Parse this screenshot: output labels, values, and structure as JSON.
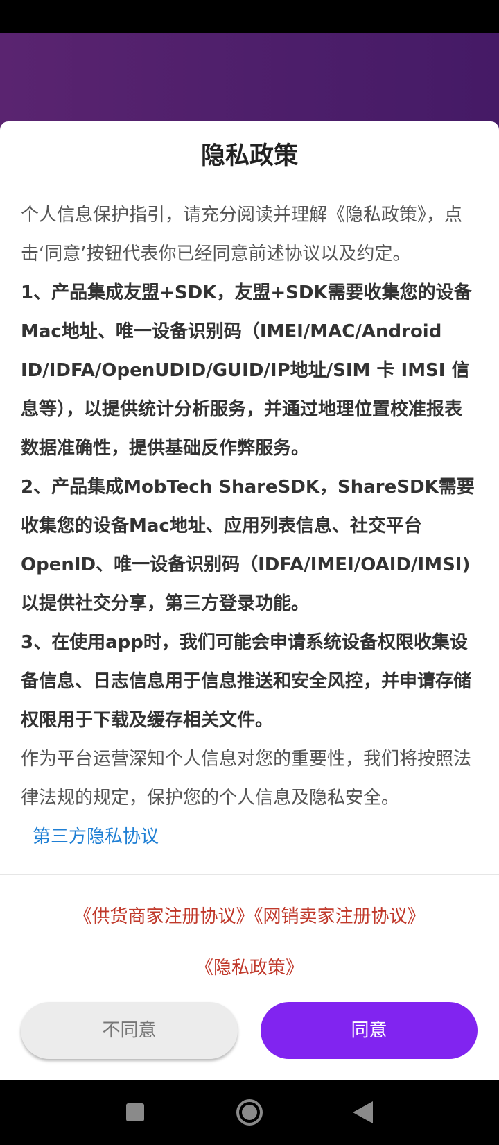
{
  "dialog": {
    "title": "隐私政策",
    "intro": "个人信息保护指引，请充分阅读并理解《隐私政策》，点击‘同意’按钮代表你已经同意前述协议以及约定。",
    "items": [
      "1、产品集成友盟+SDK，友盟+SDK需要收集您的设备Mac地址、唯一设备识别码（IMEI/MAC/Android ID/IDFA/OpenUDID/GUID/IP地址/SIM 卡 IMSI 信息等），以提供统计分析服务，并通过地理位置校准报表数据准确性，提供基础反作弊服务。",
      "2、产品集成MobTech ShareSDK，ShareSDK需要收集您的设备Mac地址、应用列表信息、社交平台OpenID、唯一设备识别码（IDFA/IMEI/OAID/IMSI)以提供社交分享，第三方登录功能。",
      "3、在使用app时，我们可能会申请系统设备权限收集设备信息、日志信息用于信息推送和安全风控，并申请存储权限用于下载及缓存相关文件。"
    ],
    "outro": "作为平台运营深知个人信息对您的重要性，我们将按照法律法规的规定，保护您的个人信息及隐私安全。",
    "third_party_link": "第三方隐私协议",
    "agreements": {
      "supplier": "《供货商家注册协议》",
      "seller": "《网销卖家注册协议》",
      "privacy": "《隐私政策》"
    },
    "buttons": {
      "decline": "不同意",
      "agree": "同意"
    }
  },
  "colors": {
    "header": "#4c1e6a",
    "accent": "#8124f0",
    "link_blue": "#1f7fd4",
    "link_red": "#c0392b"
  },
  "icons": {
    "recents": "recents-square-icon",
    "home": "home-circle-icon",
    "back": "back-triangle-icon"
  }
}
